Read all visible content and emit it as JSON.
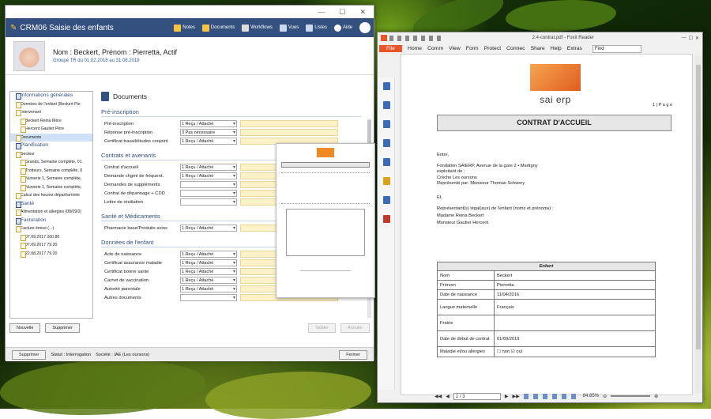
{
  "left_window": {
    "title": "CRM06 Saisie des enfants",
    "toolbar": [
      "Notes",
      "Documents",
      "Workflows",
      "Vues",
      "Listes",
      "Aide"
    ],
    "person": {
      "name": "Nom : Beckert, Prénom : Pierretta, Actif",
      "group": "Groupe  TR  du  01.02.2018  au  31.08.2019"
    },
    "sidebar": [
      {
        "label": "Informations générales",
        "kind": "sec"
      },
      {
        "label": "Données de l'enfant (Beckert Pie",
        "kind": "l1"
      },
      {
        "label": "Intervenant",
        "kind": "l1"
      },
      {
        "label": "Beckert Reina Mère",
        "kind": "l2"
      },
      {
        "label": "Hercent Gautier Père",
        "kind": "l2"
      },
      {
        "label": "Documents",
        "kind": "sel"
      },
      {
        "label": "Planification",
        "kind": "sec"
      },
      {
        "label": "Secteur",
        "kind": "l1"
      },
      {
        "label": "Grands, Semaine complète, 01.",
        "kind": "l2"
      },
      {
        "label": "Trotteurs, Semaine complète, 0",
        "kind": "l2"
      },
      {
        "label": "Nurserie 1, Semaine complète,",
        "kind": "l2"
      },
      {
        "label": "Nurserie 1, Semaine complète,",
        "kind": "l2"
      },
      {
        "label": "Calcul des heures départ/arrivée",
        "kind": "l1"
      },
      {
        "label": "Santé",
        "kind": "sec"
      },
      {
        "label": "Alimentation et allergies (08/09/2(",
        "kind": "l1"
      },
      {
        "label": "Facturation",
        "kind": "sec"
      },
      {
        "label": "Facture émise (...)",
        "kind": "l1"
      },
      {
        "label": "07.09.2017 260.80",
        "kind": "l2"
      },
      {
        "label": "07.09.2017 79.20",
        "kind": "l2"
      },
      {
        "label": "22.08.2017 79.20",
        "kind": "l2"
      }
    ],
    "docs_title": "Documents",
    "sections": [
      {
        "title": "Pré-inscription",
        "rows": [
          {
            "label": "Pré-inscription",
            "value": "1 Reçu / Attaché"
          },
          {
            "label": "Réponse pré-inscription",
            "value": "3 Pas nécessaire"
          },
          {
            "label": "Certificat travail/études conjoint",
            "value": "1 Reçu / Attaché"
          }
        ]
      },
      {
        "title": "Contrats et avenants",
        "rows": [
          {
            "label": "Contrat d'accueil",
            "value": "1 Reçu / Attaché"
          },
          {
            "label": "Demande chgmt de fréquent.",
            "value": "1 Reçu / Attaché"
          },
          {
            "label": "Demandes de suppléments",
            "value": ""
          },
          {
            "label": "Contrat de dépannage + CDD",
            "value": ""
          },
          {
            "label": "Lettre de résiliation",
            "value": ""
          }
        ]
      },
      {
        "title": "Santé et Médicaments",
        "rows": [
          {
            "label": "Pharmacie base/Produits soins",
            "value": "1 Reçu / Attaché"
          }
        ]
      },
      {
        "title": "Données de l'enfant",
        "rows": [
          {
            "label": "Acte de naissance",
            "value": "1 Reçu / Attaché"
          },
          {
            "label": "Certificat assurance maladie",
            "value": "1 Reçu / Attaché"
          },
          {
            "label": "Certificat bonne santé",
            "value": "1 Reçu / Attaché"
          },
          {
            "label": "Carnet de vaccination",
            "value": "1 Reçu / Attaché"
          },
          {
            "label": "Autorité parentale",
            "value": "1 Reçu / Attaché"
          },
          {
            "label": "Autres documents",
            "value": ""
          }
        ]
      }
    ],
    "buttons": {
      "new": "Nouvelle",
      "delete": "Supprimer",
      "validate": "Valider",
      "cancel": "Annuler"
    },
    "status": {
      "delete": "Supprimer",
      "mode": "Statut : Interrogation",
      "company": "Société : IAE (Les oursons)",
      "close": "Fermer"
    }
  },
  "pdf_window": {
    "title": "2.4-contrat.pdf - Foxit Reader",
    "menu": [
      "File",
      "Home",
      "Comm",
      "View",
      "Form",
      "Protect",
      "Connec",
      "Share",
      "Help",
      "Extras"
    ],
    "find_placeholder": "Find",
    "logo_text": "sai erp",
    "page_label": "1 | P a g e",
    "contract_title": "CONTRAT D'ACCUEIL",
    "lines": [
      "Entre,",
      "Fondation SAIERP, Avenue de la gare 2 • Martigny",
      "exploitant de :",
      "Crèche Les oursons",
      "Représenté par: Monsieur Thomas Schwery",
      "Et,",
      "Représentant(s) légal(aux) de l'enfant (noms et prénoms) :",
      "Madame Reina Beckert",
      "Monsieur Gautier Hercent"
    ],
    "table_header": "Enfant",
    "table": [
      [
        "Nom",
        "Beckert"
      ],
      [
        "Prénom",
        "Pierretta"
      ],
      [
        "Date de naissance",
        "11/04/2016"
      ],
      [
        "Langue maternelle",
        "Français"
      ],
      [
        "Fratrie",
        ""
      ],
      [
        "Date de début de contrat",
        "01/09/2019"
      ],
      [
        "Maladie et/ou allergies",
        "☐ non ☑ oui"
      ]
    ],
    "page_nav": "1 / 3",
    "zoom": "84.85%"
  }
}
